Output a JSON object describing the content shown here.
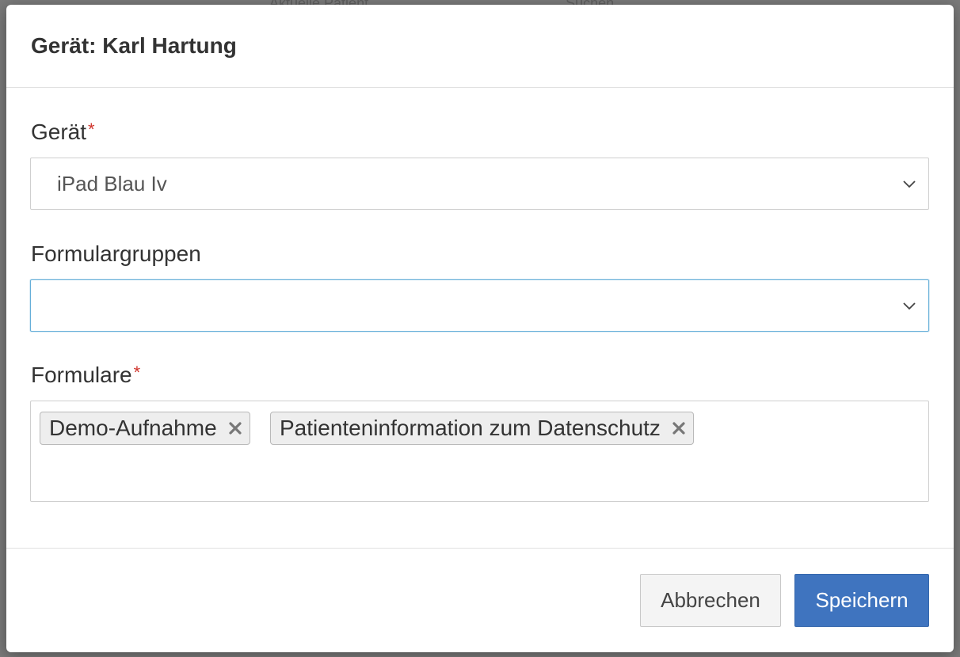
{
  "background": {
    "hints": [
      "Aktuelle Patient",
      "Suchen"
    ]
  },
  "modal": {
    "title": "Gerät: Karl Hartung"
  },
  "form": {
    "device": {
      "label": "Gerät",
      "required_mark": "*",
      "value": "iPad Blau Iv",
      "icon": "chevron-down-icon"
    },
    "form_groups": {
      "label": "Formulargruppen",
      "value": "",
      "focused": true,
      "icon": "chevron-down-icon"
    },
    "forms": {
      "label": "Formulare",
      "required_mark": "*",
      "tags": [
        {
          "label": "Demo-Aufnahme",
          "remove_icon": "close-icon"
        },
        {
          "label": "Patienteninformation zum Datenschutz",
          "remove_icon": "close-icon"
        }
      ]
    }
  },
  "footer": {
    "cancel_label": "Abbrechen",
    "save_label": "Speichern"
  },
  "colors": {
    "required": "#d0342c",
    "primary_button": "#3f74bf",
    "focus_border": "#66afd9"
  }
}
